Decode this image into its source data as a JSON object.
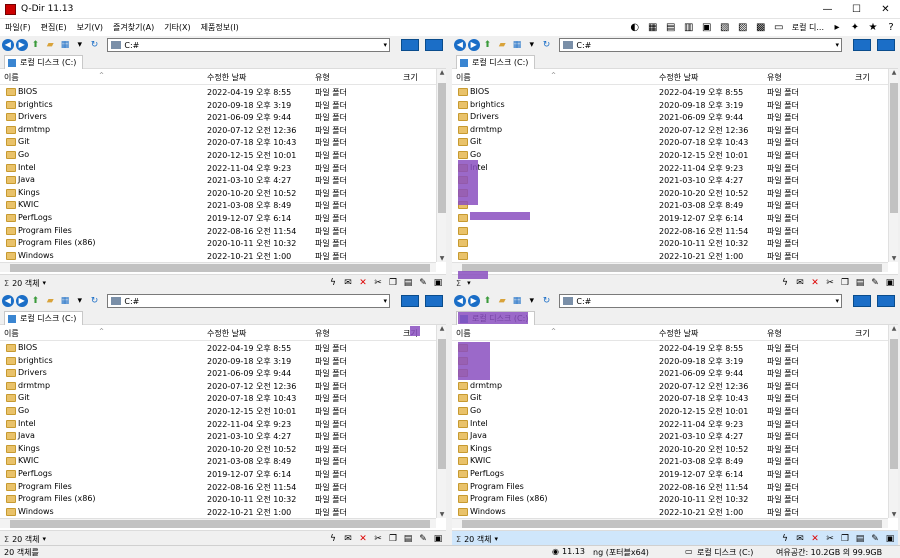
{
  "window": {
    "title": "Q-Dir 11.13"
  },
  "menu": [
    "파일(F)",
    "편집(E)",
    "보기(V)",
    "즐겨찾기(A)",
    "기타(X)",
    "제품정보(I)"
  ],
  "location_button": "로컬 디...",
  "path": "C:#",
  "tab_label": "로컬 디스크 (C:)",
  "columns": {
    "name": "이름",
    "date": "수정한 날짜",
    "type": "유형",
    "size": "크기"
  },
  "panes": {
    "tl": {
      "status": "20 객체",
      "rows": [
        {
          "name": "BIOS",
          "date": "2022-04-19 오후 8:55",
          "type": "파일 폴더"
        },
        {
          "name": "brightics",
          "date": "2020-09-18 오후 3:19",
          "type": "파일 폴더"
        },
        {
          "name": "Drivers",
          "date": "2021-06-09 오후 9:44",
          "type": "파일 폴더"
        },
        {
          "name": "drmtmp",
          "date": "2020-07-12 오전 12:36",
          "type": "파일 폴더"
        },
        {
          "name": "Git",
          "date": "2020-07-18 오후 10:43",
          "type": "파일 폴더"
        },
        {
          "name": "Go",
          "date": "2020-12-15 오전 10:01",
          "type": "파일 폴더"
        },
        {
          "name": "Intel",
          "date": "2022-11-04 오후 9:23",
          "type": "파일 폴더"
        },
        {
          "name": "Java",
          "date": "2021-03-10 오후 4:27",
          "type": "파일 폴더"
        },
        {
          "name": "Kings",
          "date": "2020-10-20 오전 10:52",
          "type": "파일 폴더"
        },
        {
          "name": "KWIC",
          "date": "2021-03-08 오후 8:49",
          "type": "파일 폴더"
        },
        {
          "name": "PerfLogs",
          "date": "2019-12-07 오후 6:14",
          "type": "파일 폴더"
        },
        {
          "name": "Program Files",
          "date": "2022-08-16 오전 11:54",
          "type": "파일 폴더"
        },
        {
          "name": "Program Files (x86)",
          "date": "2020-10-11 오전 10:32",
          "type": "파일 폴더"
        },
        {
          "name": "Windows",
          "date": "2022-10-21 오전 1:00",
          "type": "파일 폴더"
        }
      ]
    },
    "tr": {
      "status": "",
      "rows": [
        {
          "name": "BIOS",
          "date": "2022-04-19 오후 8:55",
          "type": "파일 폴더"
        },
        {
          "name": "brightics",
          "date": "2020-09-18 오후 3:19",
          "type": "파일 폴더"
        },
        {
          "name": "Drivers",
          "date": "2021-06-09 오후 9:44",
          "type": "파일 폴더"
        },
        {
          "name": "drmtmp",
          "date": "2020-07-12 오전 12:36",
          "type": "파일 폴더"
        },
        {
          "name": "Git",
          "date": "2020-07-18 오후 10:43",
          "type": "파일 폴더"
        },
        {
          "name": "Go",
          "date": "2020-12-15 오전 10:01",
          "type": "파일 폴더"
        },
        {
          "name": "Intel",
          "date": "2022-11-04 오후 9:23",
          "type": "파일 폴더"
        },
        {
          "name": "",
          "date": "2021-03-10 오후 4:27",
          "type": "파일 폴더"
        },
        {
          "name": "",
          "date": "2020-10-20 오전 10:52",
          "type": "파일 폴더"
        },
        {
          "name": "",
          "date": "2021-03-08 오후 8:49",
          "type": "파일 폴더"
        },
        {
          "name": "",
          "date": "2019-12-07 오후 6:14",
          "type": "파일 폴더"
        },
        {
          "name": "",
          "date": "2022-08-16 오전 11:54",
          "type": "파일 폴더"
        },
        {
          "name": "",
          "date": "2020-10-11 오전 10:32",
          "type": "파일 폴더"
        },
        {
          "name": "",
          "date": "2022-10-21 오전 1:00",
          "type": "파일 폴더"
        }
      ]
    },
    "bl": {
      "status": "20 객체",
      "rows": [
        {
          "name": "BIOS",
          "date": "2022-04-19 오후 8:55",
          "type": "파일 폴더"
        },
        {
          "name": "brightics",
          "date": "2020-09-18 오후 3:19",
          "type": "파일 폴더"
        },
        {
          "name": "Drivers",
          "date": "2021-06-09 오후 9:44",
          "type": "파일 폴더"
        },
        {
          "name": "drmtmp",
          "date": "2020-07-12 오전 12:36",
          "type": "파일 폴더"
        },
        {
          "name": "Git",
          "date": "2020-07-18 오후 10:43",
          "type": "파일 폴더"
        },
        {
          "name": "Go",
          "date": "2020-12-15 오전 10:01",
          "type": "파일 폴더"
        },
        {
          "name": "Intel",
          "date": "2022-11-04 오후 9:23",
          "type": "파일 폴더"
        },
        {
          "name": "Java",
          "date": "2021-03-10 오후 4:27",
          "type": "파일 폴더"
        },
        {
          "name": "Kings",
          "date": "2020-10-20 오전 10:52",
          "type": "파일 폴더"
        },
        {
          "name": "KWIC",
          "date": "2021-03-08 오후 8:49",
          "type": "파일 폴더"
        },
        {
          "name": "PerfLogs",
          "date": "2019-12-07 오후 6:14",
          "type": "파일 폴더"
        },
        {
          "name": "Program Files",
          "date": "2022-08-16 오전 11:54",
          "type": "파일 폴더"
        },
        {
          "name": "Program Files (x86)",
          "date": "2020-10-11 오전 10:32",
          "type": "파일 폴더"
        },
        {
          "name": "Windows",
          "date": "2022-10-21 오전 1:00",
          "type": "파일 폴더"
        }
      ]
    },
    "br": {
      "status": "20 객체",
      "rows": [
        {
          "name": "",
          "date": "2022-04-19 오후 8:55",
          "type": "파일 폴더"
        },
        {
          "name": "",
          "date": "2020-09-18 오후 3:19",
          "type": "파일 폴더"
        },
        {
          "name": "",
          "date": "2021-06-09 오후 9:44",
          "type": "파일 폴더"
        },
        {
          "name": "drmtmp",
          "date": "2020-07-12 오전 12:36",
          "type": "파일 폴더"
        },
        {
          "name": "Git",
          "date": "2020-07-18 오후 10:43",
          "type": "파일 폴더"
        },
        {
          "name": "Go",
          "date": "2020-12-15 오전 10:01",
          "type": "파일 폴더"
        },
        {
          "name": "Intel",
          "date": "2022-11-04 오후 9:23",
          "type": "파일 폴더"
        },
        {
          "name": "Java",
          "date": "2021-03-10 오후 4:27",
          "type": "파일 폴더"
        },
        {
          "name": "Kings",
          "date": "2020-10-20 오전 10:52",
          "type": "파일 폴더"
        },
        {
          "name": "KWIC",
          "date": "2021-03-08 오후 8:49",
          "type": "파일 폴더"
        },
        {
          "name": "PerfLogs",
          "date": "2019-12-07 오후 6:14",
          "type": "파일 폴더"
        },
        {
          "name": "Program Files",
          "date": "2022-08-16 오전 11:54",
          "type": "파일 폴더"
        },
        {
          "name": "Program Files (x86)",
          "date": "2020-10-11 오전 10:32",
          "type": "파일 폴더"
        },
        {
          "name": "Windows",
          "date": "2022-10-21 오전 1:00",
          "type": "파일 폴더"
        }
      ]
    }
  },
  "bottombar": {
    "left": "20 객체를",
    "version": "11.13",
    "folder": "ng (포터블x64)",
    "drive": "로컬 디스크 (C:)",
    "space": "여유공간: 10.2GB 의 99.9GB"
  },
  "colors": {
    "accent": "#1b6ec7",
    "folder": "#e9c26a",
    "active_status": "#cfe6fb",
    "close_red": "#d00000"
  }
}
